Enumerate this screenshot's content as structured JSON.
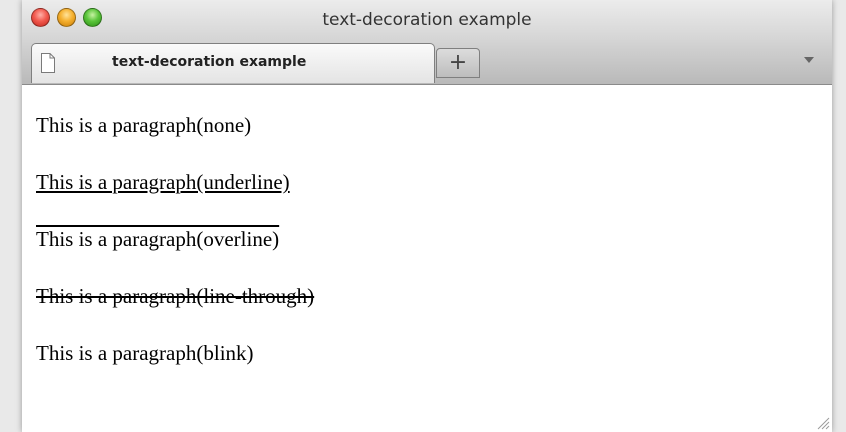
{
  "window": {
    "title": "text-decoration example"
  },
  "tabs": [
    {
      "label": "text-decoration example",
      "icon": "document-icon"
    }
  ],
  "new_tab_label": "+",
  "paragraphs": [
    {
      "text": "This is a paragraph(none)",
      "decoration": "none"
    },
    {
      "text": "This is a paragraph(underline)",
      "decoration": "underline"
    },
    {
      "text": "This is a paragraph(overline)",
      "decoration": "overline"
    },
    {
      "text": "This is a paragraph(line-through)",
      "decoration": "line-through"
    },
    {
      "text": "This is a paragraph(blink)",
      "decoration": "blink"
    }
  ],
  "colors": {
    "close": "#f25a4f",
    "minimize": "#f5b02f",
    "maximize": "#5bc53b"
  }
}
